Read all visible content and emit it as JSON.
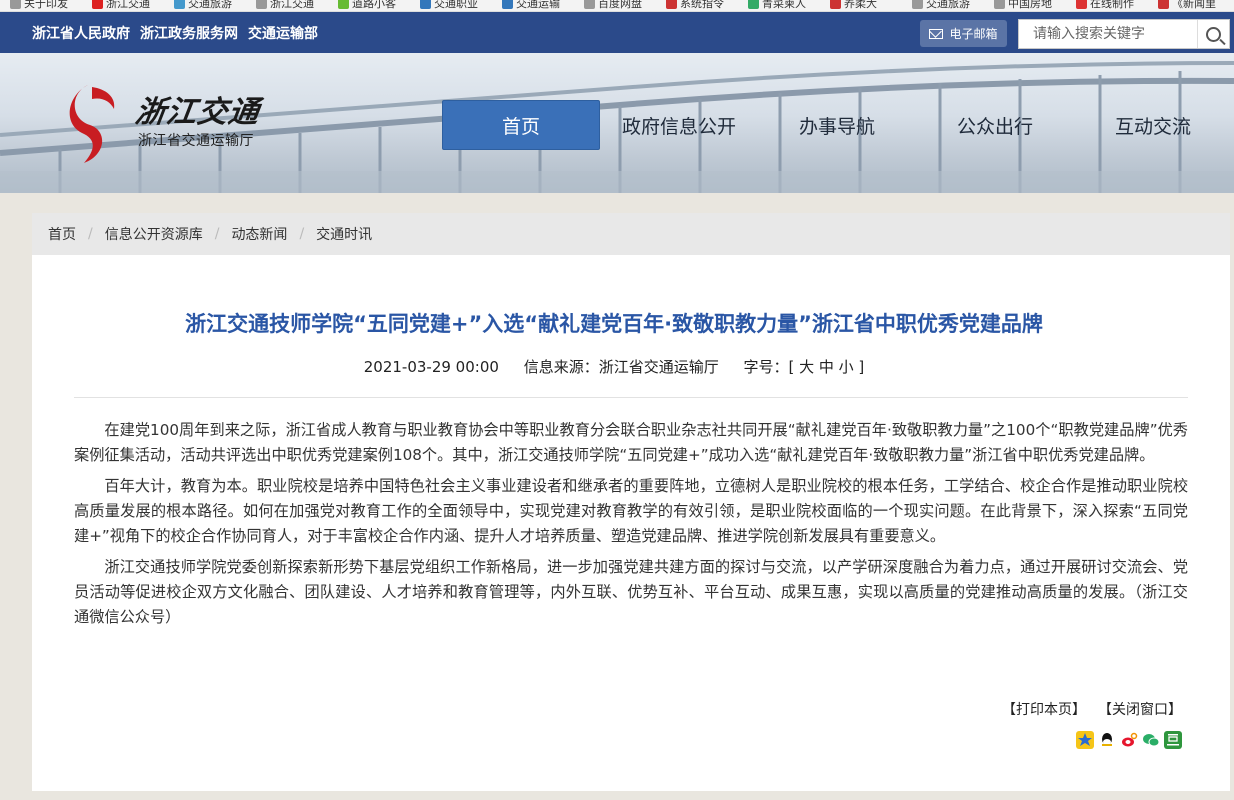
{
  "browser": {
    "bookmarks": [
      "关于印发",
      "浙江交通",
      "交通旅游",
      "浙江交通",
      "道路小客",
      "交通职业",
      "交通运输",
      "百度网盘",
      "系统指令",
      "青菜柬人",
      "养柔大",
      "交通旅游",
      "中国房地",
      "在线制作",
      "《新闻里"
    ]
  },
  "topbar": {
    "links": [
      "浙江省人民政府",
      "浙江政务服务网",
      "交通运输部"
    ],
    "mail_label": "电子邮箱",
    "search_placeholder": "请输入搜索关键字"
  },
  "header": {
    "logo_text": "浙江交通",
    "logo_sub": "浙江省交通运输厅",
    "nav": [
      "首页",
      "政府信息公开",
      "办事导航",
      "公众出行",
      "互动交流"
    ],
    "active_nav": 0
  },
  "breadcrumb": [
    "首页",
    "信息公开资源库",
    "动态新闻",
    "交通时讯"
  ],
  "article": {
    "title": "浙江交通技师学院“五同党建+”入选“献礼建党百年·致敬职教力量”浙江省中职优秀党建品牌",
    "date": "2021-03-29 00:00",
    "source": "信息来源：浙江省交通运输厅",
    "font_size": "字号：[ 大 中 小 ]",
    "paragraphs": [
      "在建党100周年到来之际，浙江省成人教育与职业教育协会中等职业教育分会联合职业杂志社共同开展“献礼建党百年·致敬职教力量”之100个“职教党建品牌”优秀案例征集活动，活动共评选出中职优秀党建案例108个。其中，浙江交通技师学院“五同党建+”成功入选“献礼建党百年·致敬职教力量”浙江省中职优秀党建品牌。",
      "百年大计，教育为本。职业院校是培养中国特色社会主义事业建设者和继承者的重要阵地，立德树人是职业院校的根本任务，工学结合、校企合作是推动职业院校高质量发展的根本路径。如何在加强党对教育工作的全面领导中，实现党建对教育教学的有效引领，是职业院校面临的一个现实问题。在此背景下，深入探索“五同党建+”视角下的校企合作协同育人，对于丰富校企合作内涵、提升人才培养质量、塑造党建品牌、推进学院创新发展具有重要意义。",
      "浙江交通技师学院党委创新探索新形势下基层党组织工作新格局，进一步加强党建共建方面的探讨与交流，以产学研深度融合为着力点，通过开展研讨交流会、党员活动等促进校企双方文化融合、团队建设、人才培养和教育管理等，内外互联、优势互补、平台互动、成果互惠，实现以高质量的党建推动高质量的发展。（浙江交通微信公众号）"
    ],
    "print_label": "【打印本页】",
    "close_label": "【关闭窗口】"
  },
  "share_icons": [
    "qzone-icon",
    "qq-icon",
    "weibo-icon",
    "wechat-icon",
    "douban-icon"
  ],
  "colors": {
    "topbar": "#2b4a8a",
    "nav_active": "#3a70b8",
    "title": "#2a56a5"
  }
}
